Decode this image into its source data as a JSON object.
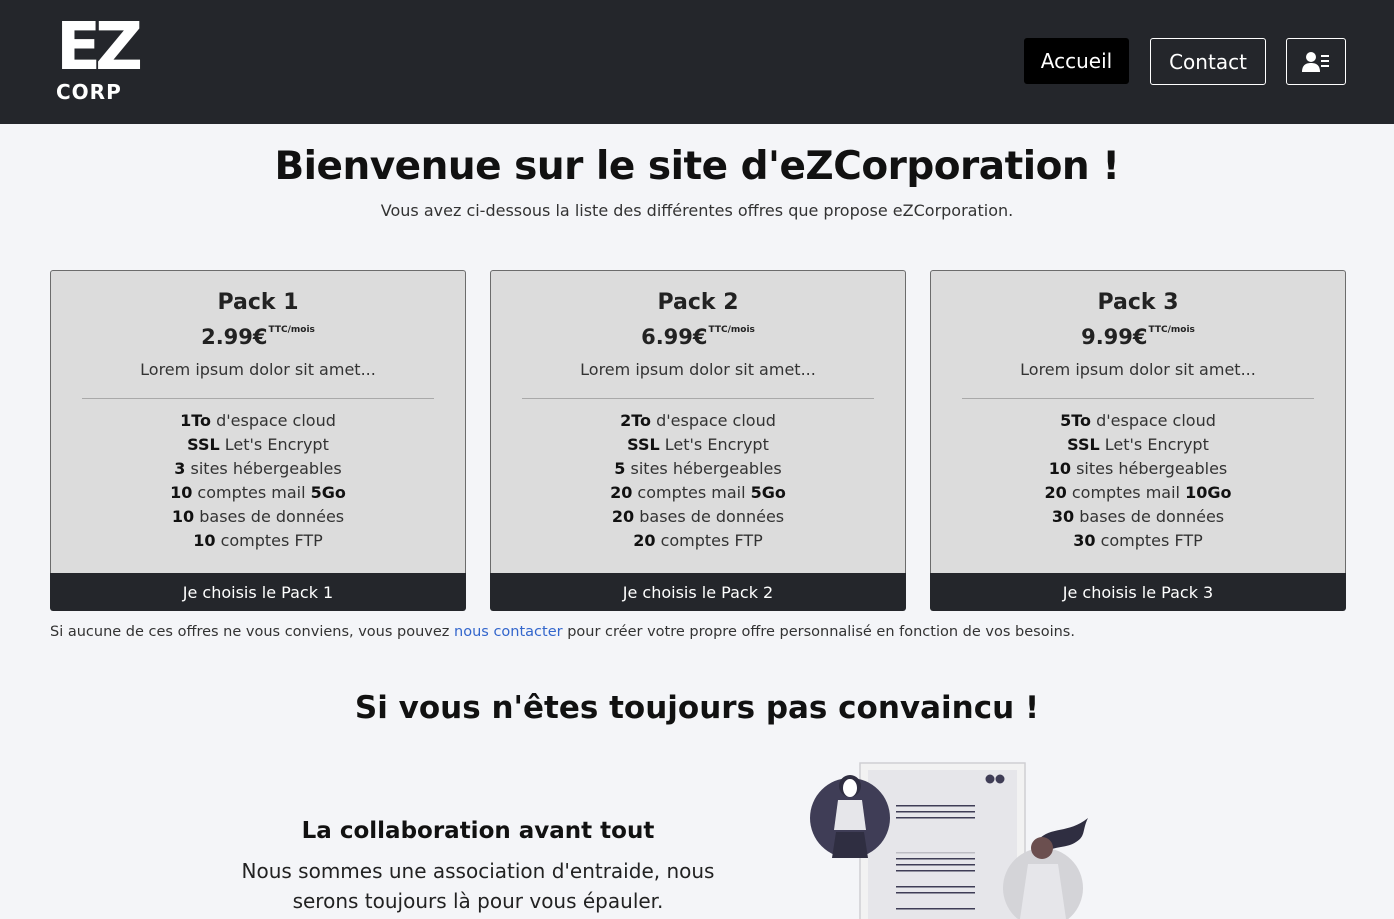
{
  "header": {
    "logo_top": "EZ",
    "logo_bottom": "CORP",
    "nav": {
      "home": "Accueil",
      "contact": "Contact",
      "user_icon": "user-list-icon"
    }
  },
  "hero": {
    "title": "Bienvenue sur le site d'eZCorporation !",
    "subtitle": "Vous avez ci-dessous la liste des différentes offres que propose eZCorporation."
  },
  "packs": [
    {
      "title": "Pack 1",
      "price": "2.99€",
      "price_unit": "TTC/mois",
      "desc": "Lorem ipsum dolor sit amet...",
      "features": [
        {
          "bold": "1To",
          "text": " d'espace cloud"
        },
        {
          "bold": "SSL",
          "text": " Let's Encrypt"
        },
        {
          "bold": "3",
          "text": " sites hébergeables"
        },
        {
          "bold": "10",
          "text": " comptes mail ",
          "bold2": "5Go"
        },
        {
          "bold": "10",
          "text": " bases de données"
        },
        {
          "bold": "10",
          "text": " comptes FTP"
        }
      ],
      "button": "Je choisis le Pack 1"
    },
    {
      "title": "Pack 2",
      "price": "6.99€",
      "price_unit": "TTC/mois",
      "desc": "Lorem ipsum dolor sit amet...",
      "features": [
        {
          "bold": "2To",
          "text": " d'espace cloud"
        },
        {
          "bold": "SSL",
          "text": " Let's Encrypt"
        },
        {
          "bold": "5",
          "text": " sites hébergeables"
        },
        {
          "bold": "20",
          "text": " comptes mail ",
          "bold2": "5Go"
        },
        {
          "bold": "20",
          "text": " bases de données"
        },
        {
          "bold": "20",
          "text": " comptes FTP"
        }
      ],
      "button": "Je choisis le Pack 2"
    },
    {
      "title": "Pack 3",
      "price": "9.99€",
      "price_unit": "TTC/mois",
      "desc": "Lorem ipsum dolor sit amet...",
      "features": [
        {
          "bold": "5To",
          "text": " d'espace cloud"
        },
        {
          "bold": "SSL",
          "text": " Let's Encrypt"
        },
        {
          "bold": "10",
          "text": " sites hébergeables"
        },
        {
          "bold": "20",
          "text": " comptes mail ",
          "bold2": "10Go"
        },
        {
          "bold": "30",
          "text": " bases de données"
        },
        {
          "bold": "30",
          "text": " comptes FTP"
        }
      ],
      "button": "Je choisis le Pack 3"
    }
  ],
  "note": {
    "before": "Si aucune de ces offres ne vous conviens, vous pouvez ",
    "link": "nous contacter",
    "after": " pour créer votre propre offre personnalisé en fonction de vos besoins."
  },
  "convince": {
    "title": "Si vous n'êtes toujours pas convaincu !",
    "collab_title": "La collaboration avant tout",
    "collab_text": "Nous sommes une association d'entraide, nous serons toujours là pour vous épauler."
  },
  "colors": {
    "header_bg": "#24262b",
    "card_bg": "#dcdcdc",
    "link": "#3366cc",
    "page_bg": "#f4f5f8"
  }
}
